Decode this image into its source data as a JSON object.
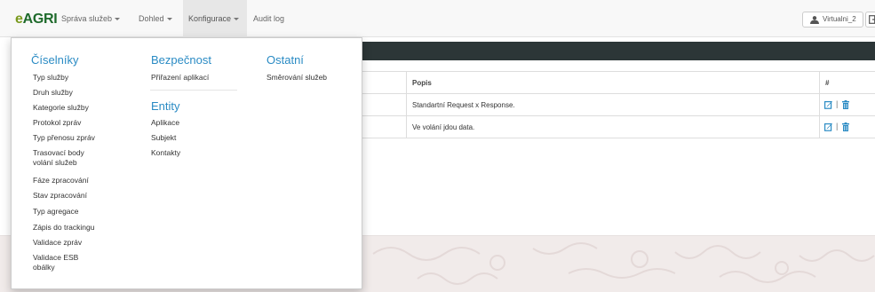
{
  "brand": {
    "prefix": "e",
    "name": "AGRI"
  },
  "nav": {
    "items": [
      {
        "label": "Správa služeb"
      },
      {
        "label": "Dohled"
      },
      {
        "label": "Konfigurace"
      },
      {
        "label": "Audit log"
      }
    ],
    "user": "Virtualni_2"
  },
  "table": {
    "headers": [
      "",
      "Popis",
      "#"
    ],
    "rows": [
      {
        "popis": "Standartní Request x Response."
      },
      {
        "popis": "Ve volání jdou data."
      }
    ],
    "action_separator": "|"
  },
  "menu": {
    "ciselniky": {
      "heading": "Číselníky",
      "items": [
        "Typ služby",
        "Druh služby",
        "Kategorie služby",
        "Protokol zpráv",
        "Typ přenosu zpráv",
        "Trasovací body",
        "volání služeb",
        "Fáze zpracování",
        "Stav zpracování",
        "Typ agregace",
        "Zápis do trackingu",
        "Validace zpráv",
        "Validace ESB",
        "obálky"
      ]
    },
    "bezpecnost": {
      "heading": "Bezpečnost",
      "items": [
        "Přiřazení aplikací"
      ]
    },
    "entity": {
      "heading": "Entity",
      "items": [
        "Aplikace",
        "Subjekt",
        "Kontakty"
      ]
    },
    "ostatni": {
      "heading": "Ostatní",
      "items": [
        "Směrování služeb"
      ]
    }
  },
  "colors": {
    "brand_light": "#7a9a1e",
    "brand_dark": "#1e6a2b",
    "heading": "#2a8bc4",
    "icon": "#2a8bc4",
    "header_bar": "#2c3637"
  },
  "icons": {
    "user": "user-icon",
    "logout": "logout-icon",
    "edit": "edit-icon",
    "delete": "trash-icon"
  }
}
